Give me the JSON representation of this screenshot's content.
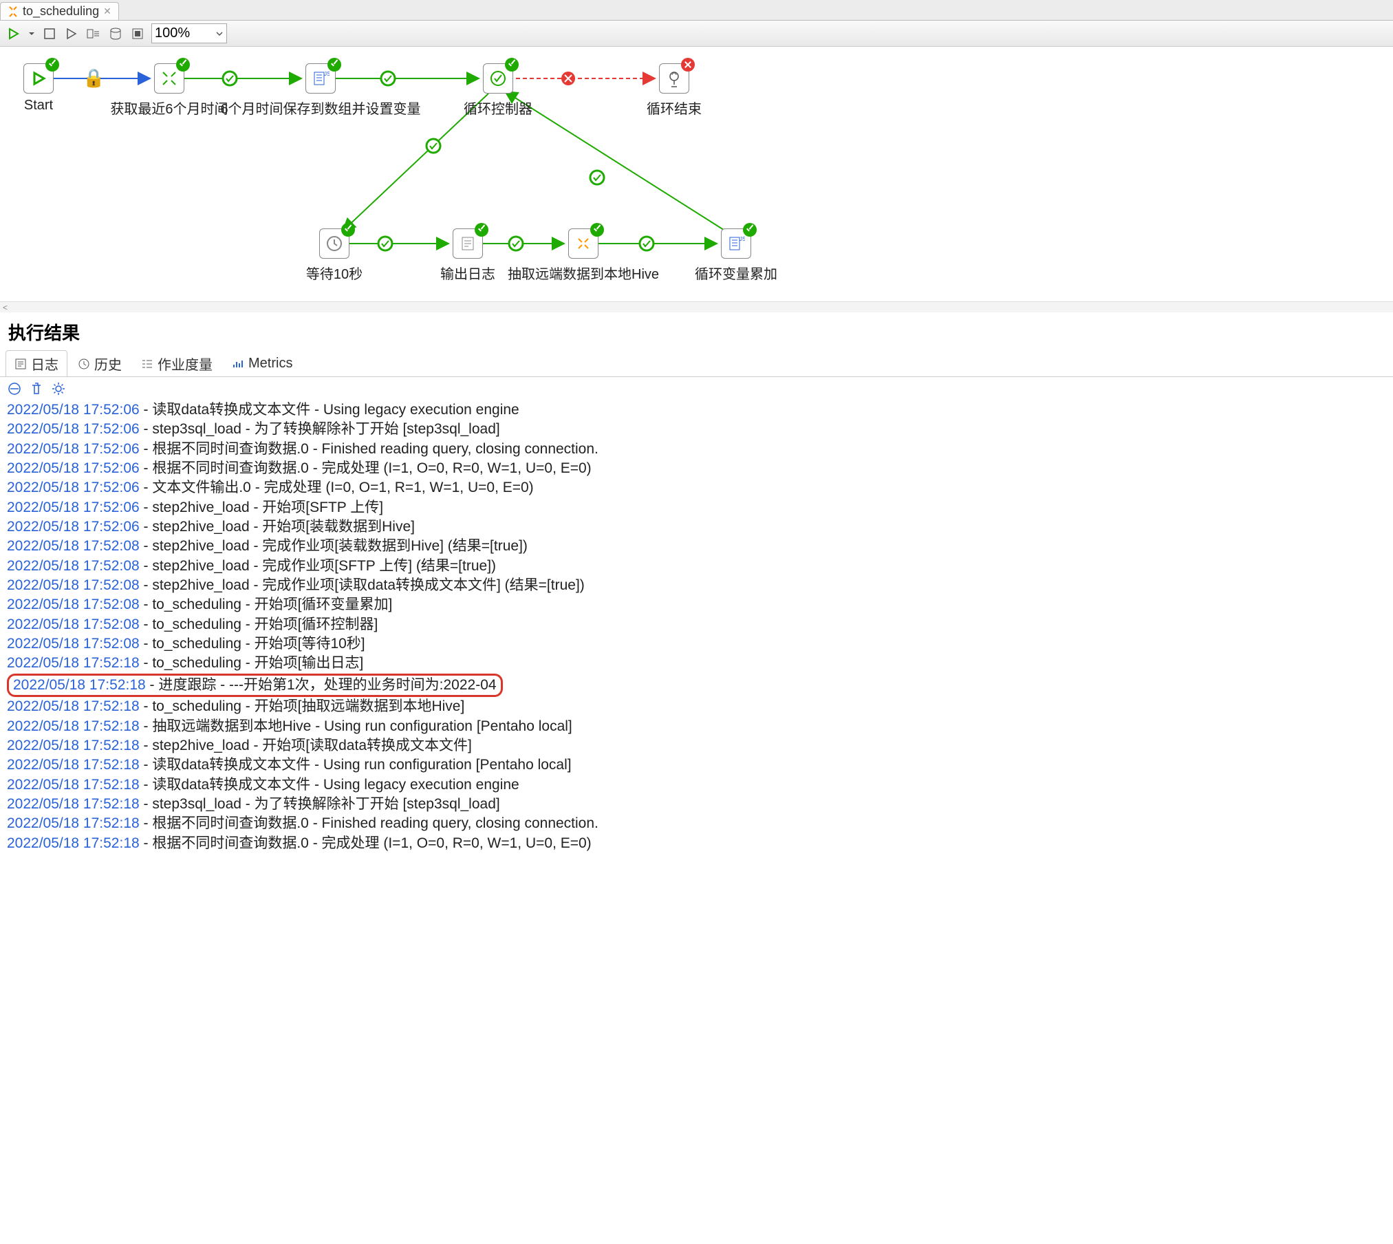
{
  "tab": {
    "title": "to_scheduling"
  },
  "toolbar": {
    "zoom": "100%"
  },
  "nodes": {
    "start": "Start",
    "get6m": "获取最近6个月时间",
    "save6m": "6个月时间保存到数组并设置变量",
    "loopctrl": "循环控制器",
    "loopend": "循环结束",
    "wait10": "等待10秒",
    "outlog": "输出日志",
    "extract": "抽取远端数据到本地Hive",
    "loopinc": "循环变量累加"
  },
  "results": {
    "title": "执行结果",
    "tabs": {
      "log": "日志",
      "history": "历史",
      "jobmetric": "作业度量",
      "metrics": "Metrics"
    }
  },
  "log_lines": [
    {
      "ts": "2022/05/18 17:52:06",
      "msg": " - 读取data转换成文本文件 - Using legacy execution engine",
      "hl": false
    },
    {
      "ts": "2022/05/18 17:52:06",
      "msg": " - step3sql_load - 为了转换解除补丁开始  [step3sql_load]",
      "hl": false
    },
    {
      "ts": "2022/05/18 17:52:06",
      "msg": " - 根据不同时间查询数据.0 - Finished reading query, closing connection.",
      "hl": false
    },
    {
      "ts": "2022/05/18 17:52:06",
      "msg": " - 根据不同时间查询数据.0 - 完成处理 (I=1, O=0, R=0, W=1, U=0, E=0)",
      "hl": false
    },
    {
      "ts": "2022/05/18 17:52:06",
      "msg": " - 文本文件输出.0 - 完成处理 (I=0, O=1, R=1, W=1, U=0, E=0)",
      "hl": false
    },
    {
      "ts": "2022/05/18 17:52:06",
      "msg": " - step2hive_load - 开始项[SFTP 上传]",
      "hl": false
    },
    {
      "ts": "2022/05/18 17:52:06",
      "msg": " - step2hive_load - 开始项[装载数据到Hive]",
      "hl": false
    },
    {
      "ts": "2022/05/18 17:52:08",
      "msg": " - step2hive_load - 完成作业项[装载数据到Hive] (结果=[true])",
      "hl": false
    },
    {
      "ts": "2022/05/18 17:52:08",
      "msg": " - step2hive_load - 完成作业项[SFTP 上传] (结果=[true])",
      "hl": false
    },
    {
      "ts": "2022/05/18 17:52:08",
      "msg": " - step2hive_load - 完成作业项[读取data转换成文本文件] (结果=[true])",
      "hl": false
    },
    {
      "ts": "2022/05/18 17:52:08",
      "msg": " - to_scheduling - 开始项[循环变量累加]",
      "hl": false
    },
    {
      "ts": "2022/05/18 17:52:08",
      "msg": " - to_scheduling - 开始项[循环控制器]",
      "hl": false
    },
    {
      "ts": "2022/05/18 17:52:08",
      "msg": " - to_scheduling - 开始项[等待10秒]",
      "hl": false
    },
    {
      "ts": "2022/05/18 17:52:18",
      "msg": " - to_scheduling - 开始项[输出日志]",
      "hl": false
    },
    {
      "ts": "2022/05/18 17:52:18",
      "msg": " - 进度跟踪 - ---开始第1次，处理的业务时间为:2022-04",
      "hl": true
    },
    {
      "ts": "2022/05/18 17:52:18",
      "msg": " - to_scheduling - 开始项[抽取远端数据到本地Hive]",
      "hl": false
    },
    {
      "ts": "2022/05/18 17:52:18",
      "msg": " - 抽取远端数据到本地Hive - Using run configuration [Pentaho local]",
      "hl": false
    },
    {
      "ts": "2022/05/18 17:52:18",
      "msg": " - step2hive_load - 开始项[读取data转换成文本文件]",
      "hl": false
    },
    {
      "ts": "2022/05/18 17:52:18",
      "msg": " - 读取data转换成文本文件 - Using run configuration [Pentaho local]",
      "hl": false
    },
    {
      "ts": "2022/05/18 17:52:18",
      "msg": " - 读取data转换成文本文件 - Using legacy execution engine",
      "hl": false
    },
    {
      "ts": "2022/05/18 17:52:18",
      "msg": " - step3sql_load - 为了转换解除补丁开始  [step3sql_load]",
      "hl": false
    },
    {
      "ts": "2022/05/18 17:52:18",
      "msg": " - 根据不同时间查询数据.0 - Finished reading query, closing connection.",
      "hl": false
    },
    {
      "ts": "2022/05/18 17:52:18",
      "msg": " - 根据不同时间查询数据.0 - 完成处理 (I=1, O=0, R=0, W=1, U=0, E=0)",
      "hl": false
    }
  ]
}
